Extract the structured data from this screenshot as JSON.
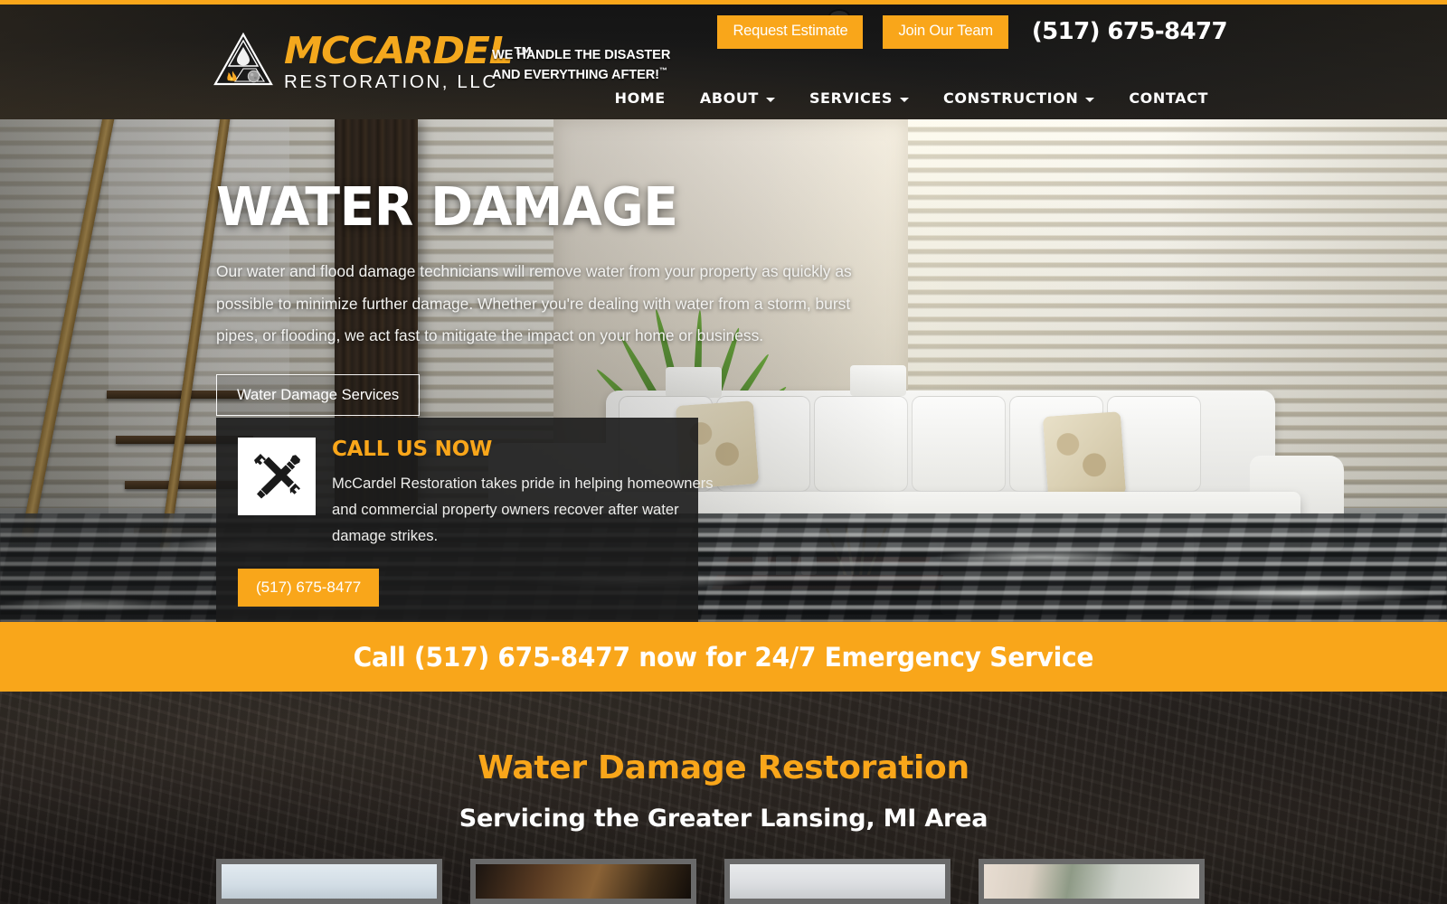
{
  "brand": {
    "name_line1": "MCCARDEL",
    "name_tm": "TM",
    "name_line2": "RESTORATION, LLC",
    "tagline_line1": "WE HANDLE THE DISASTER",
    "tagline_line2": "AND EVERYTHING AFTER!",
    "tagline_tm": "™",
    "accent_color": "#f9a61a",
    "logo_icons": [
      "water-drop-icon",
      "flame-icon",
      "mold-sphere-icon"
    ]
  },
  "header": {
    "request_estimate_label": "Request Estimate",
    "join_team_label": "Join Our Team",
    "phone": "(517) 675-8477",
    "nav": [
      {
        "label": "HOME",
        "has_dropdown": false
      },
      {
        "label": "ABOUT",
        "has_dropdown": true
      },
      {
        "label": "SERVICES",
        "has_dropdown": true
      },
      {
        "label": "CONSTRUCTION",
        "has_dropdown": true
      },
      {
        "label": "CONTACT",
        "has_dropdown": false
      }
    ]
  },
  "hero": {
    "title": "WATER DAMAGE",
    "body": "Our water and flood damage technicians will remove water from your property as quickly as possible to minimize further damage. Whether you're dealing with water from a storm, burst pipes, or flooding, we act fast to mitigate the impact on your home or business.",
    "cta_label": "Water Damage Services",
    "callbox": {
      "icon": "pen-and-ruler-icon",
      "title": "CALL US NOW",
      "text": "McCardel Restoration takes pride in helping homeowners and commercial property owners recover after water damage strikes.",
      "phone_button_label": "(517) 675-8477"
    }
  },
  "banner": {
    "text": "Call (517) 675-8477 now for 24/7 Emergency Service",
    "background_color": "#f9a61a"
  },
  "section": {
    "title": "Water Damage Restoration",
    "subtitle": "Servicing the Greater Lansing, MI Area",
    "cards": [
      {
        "name": "gallery-card-ceiling-water-damage"
      },
      {
        "name": "gallery-card-attic-framing"
      },
      {
        "name": "gallery-card-wall-damage"
      },
      {
        "name": "gallery-card-water-stained-wall"
      }
    ]
  }
}
